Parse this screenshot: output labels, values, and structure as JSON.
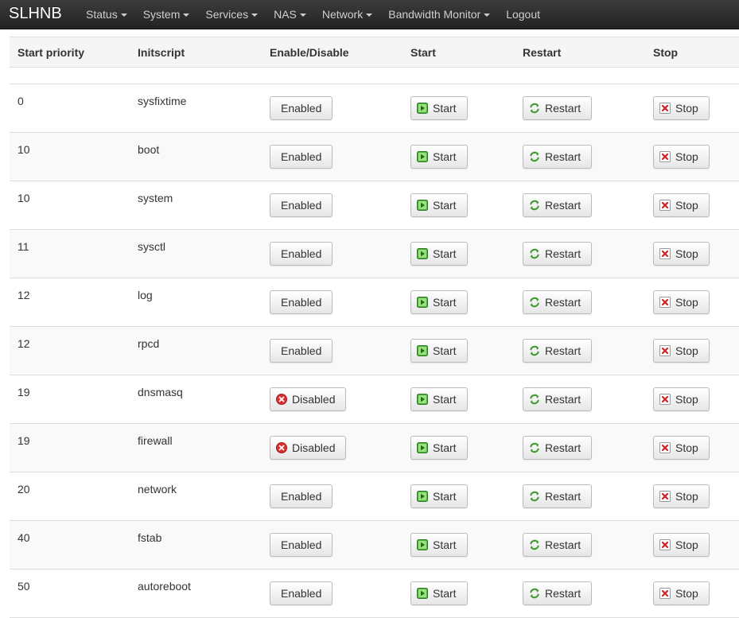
{
  "brand": "SLHNB",
  "menu": [
    {
      "label": "Status",
      "dropdown": true
    },
    {
      "label": "System",
      "dropdown": true
    },
    {
      "label": "Services",
      "dropdown": true
    },
    {
      "label": "NAS",
      "dropdown": true
    },
    {
      "label": "Network",
      "dropdown": true
    },
    {
      "label": "Bandwidth Monitor",
      "dropdown": true
    },
    {
      "label": "Logout",
      "dropdown": false
    }
  ],
  "table": {
    "headers": [
      "Start priority",
      "Initscript",
      "Enable/Disable",
      "Start",
      "Restart",
      "Stop"
    ],
    "rows": [
      {
        "priority": "0",
        "script": "sysfixtime",
        "state": "Enabled"
      },
      {
        "priority": "10",
        "script": "boot",
        "state": "Enabled"
      },
      {
        "priority": "10",
        "script": "system",
        "state": "Enabled"
      },
      {
        "priority": "11",
        "script": "sysctl",
        "state": "Enabled"
      },
      {
        "priority": "12",
        "script": "log",
        "state": "Enabled"
      },
      {
        "priority": "12",
        "script": "rpcd",
        "state": "Enabled"
      },
      {
        "priority": "19",
        "script": "dnsmasq",
        "state": "Disabled"
      },
      {
        "priority": "19",
        "script": "firewall",
        "state": "Disabled"
      },
      {
        "priority": "20",
        "script": "network",
        "state": "Enabled"
      },
      {
        "priority": "40",
        "script": "fstab",
        "state": "Enabled"
      },
      {
        "priority": "50",
        "script": "autoreboot",
        "state": "Enabled"
      }
    ],
    "start_label": "Start",
    "restart_label": "Restart",
    "stop_label": "Stop"
  },
  "icons": {
    "start": "start-icon",
    "restart": "restart-icon",
    "stop": "stop-icon",
    "disabled": "disabled-icon"
  },
  "colors": {
    "navbar": "#2d2d2d",
    "start_green": "#3aa637",
    "restart_green": "#3c9a2a",
    "stop_red": "#d42222",
    "disabled_red": "#d9302f"
  }
}
